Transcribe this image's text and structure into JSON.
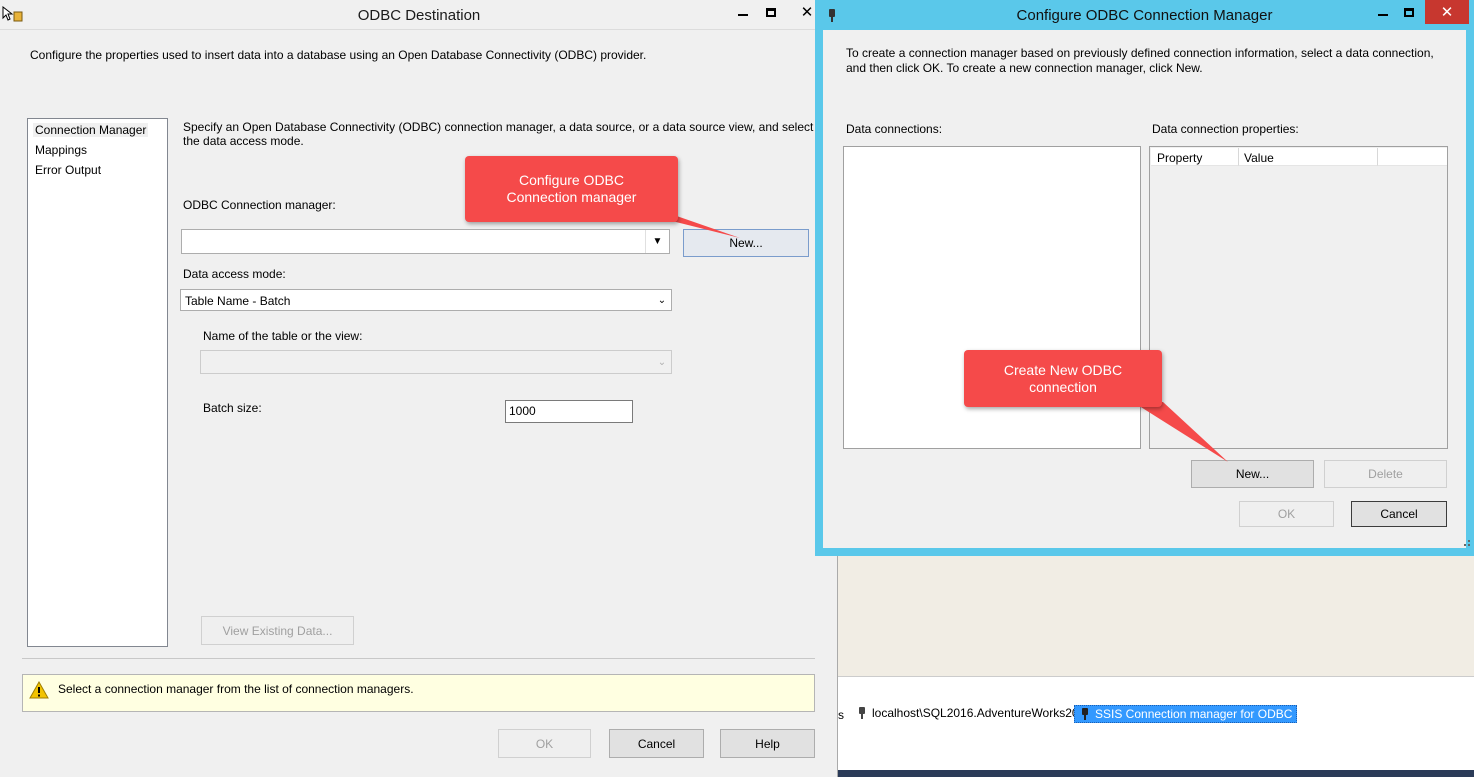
{
  "dest": {
    "title": "ODBC Destination",
    "description": "Configure the properties used to insert data into a database using an Open Database Connectivity (ODBC) provider.",
    "nav": [
      "Connection Manager",
      "Mappings",
      "Error Output"
    ],
    "instructions_line1": "Specify an Open Database Connectivity (ODBC) connection manager, a data source, or a data source view, and select",
    "instructions_line2": "the data access mode.",
    "conn_label": "ODBC Connection manager:",
    "conn_value": "",
    "new_label": "New...",
    "mode_label": "Data access mode:",
    "mode_value": "Table Name - Batch",
    "table_label": "Name of the table or the view:",
    "table_value": "",
    "batch_label": "Batch size:",
    "batch_value": "1000",
    "view_label": "View Existing Data...",
    "warning_text": "Select a connection manager from the list of connection managers.",
    "ok_label": "OK",
    "cancel_label": "Cancel",
    "help_label": "Help"
  },
  "callouts": {
    "c1": [
      "Configure ODBC",
      "Connection manager"
    ],
    "c2": [
      "Create New ODBC",
      "connection"
    ]
  },
  "cfg": {
    "title": "Configure ODBC Connection Manager",
    "intro_line1": "To create a connection manager based on previously defined connection information, select a data connection,",
    "intro_line2": "and then click OK. To create a new connection manager, click New.",
    "data_conn_label": "Data connections:",
    "props_label": "Data connection properties:",
    "col_property": "Property",
    "col_value": "Value",
    "new_label": "New...",
    "delete_label": "Delete",
    "ok_label": "OK",
    "cancel_label": "Cancel"
  },
  "bg": {
    "tray_partial": "s",
    "conn1": "localhost\\SQL2016.AdventureWorks2014",
    "conn2": "SSIS Connection manager for ODBC"
  },
  "colors": {
    "callout": "#f54a4a",
    "window_frame": "#5ac8ea",
    "selection": "#3399ff"
  }
}
